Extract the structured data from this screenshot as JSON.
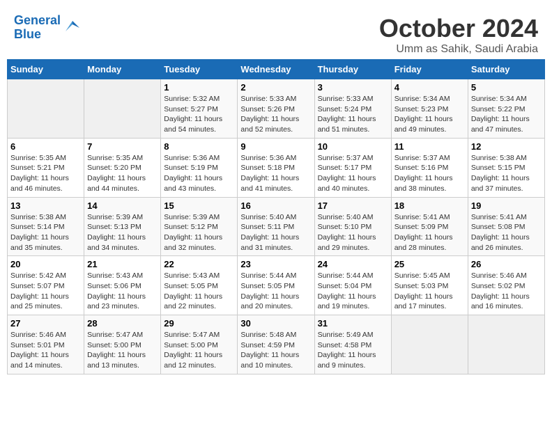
{
  "header": {
    "logo_line1": "General",
    "logo_line2": "Blue",
    "month": "October 2024",
    "location": "Umm as Sahik, Saudi Arabia"
  },
  "weekdays": [
    "Sunday",
    "Monday",
    "Tuesday",
    "Wednesday",
    "Thursday",
    "Friday",
    "Saturday"
  ],
  "weeks": [
    [
      {
        "day": null
      },
      {
        "day": null
      },
      {
        "day": "1",
        "sunrise": "Sunrise: 5:32 AM",
        "sunset": "Sunset: 5:27 PM",
        "daylight": "Daylight: 11 hours and 54 minutes."
      },
      {
        "day": "2",
        "sunrise": "Sunrise: 5:33 AM",
        "sunset": "Sunset: 5:26 PM",
        "daylight": "Daylight: 11 hours and 52 minutes."
      },
      {
        "day": "3",
        "sunrise": "Sunrise: 5:33 AM",
        "sunset": "Sunset: 5:24 PM",
        "daylight": "Daylight: 11 hours and 51 minutes."
      },
      {
        "day": "4",
        "sunrise": "Sunrise: 5:34 AM",
        "sunset": "Sunset: 5:23 PM",
        "daylight": "Daylight: 11 hours and 49 minutes."
      },
      {
        "day": "5",
        "sunrise": "Sunrise: 5:34 AM",
        "sunset": "Sunset: 5:22 PM",
        "daylight": "Daylight: 11 hours and 47 minutes."
      }
    ],
    [
      {
        "day": "6",
        "sunrise": "Sunrise: 5:35 AM",
        "sunset": "Sunset: 5:21 PM",
        "daylight": "Daylight: 11 hours and 46 minutes."
      },
      {
        "day": "7",
        "sunrise": "Sunrise: 5:35 AM",
        "sunset": "Sunset: 5:20 PM",
        "daylight": "Daylight: 11 hours and 44 minutes."
      },
      {
        "day": "8",
        "sunrise": "Sunrise: 5:36 AM",
        "sunset": "Sunset: 5:19 PM",
        "daylight": "Daylight: 11 hours and 43 minutes."
      },
      {
        "day": "9",
        "sunrise": "Sunrise: 5:36 AM",
        "sunset": "Sunset: 5:18 PM",
        "daylight": "Daylight: 11 hours and 41 minutes."
      },
      {
        "day": "10",
        "sunrise": "Sunrise: 5:37 AM",
        "sunset": "Sunset: 5:17 PM",
        "daylight": "Daylight: 11 hours and 40 minutes."
      },
      {
        "day": "11",
        "sunrise": "Sunrise: 5:37 AM",
        "sunset": "Sunset: 5:16 PM",
        "daylight": "Daylight: 11 hours and 38 minutes."
      },
      {
        "day": "12",
        "sunrise": "Sunrise: 5:38 AM",
        "sunset": "Sunset: 5:15 PM",
        "daylight": "Daylight: 11 hours and 37 minutes."
      }
    ],
    [
      {
        "day": "13",
        "sunrise": "Sunrise: 5:38 AM",
        "sunset": "Sunset: 5:14 PM",
        "daylight": "Daylight: 11 hours and 35 minutes."
      },
      {
        "day": "14",
        "sunrise": "Sunrise: 5:39 AM",
        "sunset": "Sunset: 5:13 PM",
        "daylight": "Daylight: 11 hours and 34 minutes."
      },
      {
        "day": "15",
        "sunrise": "Sunrise: 5:39 AM",
        "sunset": "Sunset: 5:12 PM",
        "daylight": "Daylight: 11 hours and 32 minutes."
      },
      {
        "day": "16",
        "sunrise": "Sunrise: 5:40 AM",
        "sunset": "Sunset: 5:11 PM",
        "daylight": "Daylight: 11 hours and 31 minutes."
      },
      {
        "day": "17",
        "sunrise": "Sunrise: 5:40 AM",
        "sunset": "Sunset: 5:10 PM",
        "daylight": "Daylight: 11 hours and 29 minutes."
      },
      {
        "day": "18",
        "sunrise": "Sunrise: 5:41 AM",
        "sunset": "Sunset: 5:09 PM",
        "daylight": "Daylight: 11 hours and 28 minutes."
      },
      {
        "day": "19",
        "sunrise": "Sunrise: 5:41 AM",
        "sunset": "Sunset: 5:08 PM",
        "daylight": "Daylight: 11 hours and 26 minutes."
      }
    ],
    [
      {
        "day": "20",
        "sunrise": "Sunrise: 5:42 AM",
        "sunset": "Sunset: 5:07 PM",
        "daylight": "Daylight: 11 hours and 25 minutes."
      },
      {
        "day": "21",
        "sunrise": "Sunrise: 5:43 AM",
        "sunset": "Sunset: 5:06 PM",
        "daylight": "Daylight: 11 hours and 23 minutes."
      },
      {
        "day": "22",
        "sunrise": "Sunrise: 5:43 AM",
        "sunset": "Sunset: 5:05 PM",
        "daylight": "Daylight: 11 hours and 22 minutes."
      },
      {
        "day": "23",
        "sunrise": "Sunrise: 5:44 AM",
        "sunset": "Sunset: 5:05 PM",
        "daylight": "Daylight: 11 hours and 20 minutes."
      },
      {
        "day": "24",
        "sunrise": "Sunrise: 5:44 AM",
        "sunset": "Sunset: 5:04 PM",
        "daylight": "Daylight: 11 hours and 19 minutes."
      },
      {
        "day": "25",
        "sunrise": "Sunrise: 5:45 AM",
        "sunset": "Sunset: 5:03 PM",
        "daylight": "Daylight: 11 hours and 17 minutes."
      },
      {
        "day": "26",
        "sunrise": "Sunrise: 5:46 AM",
        "sunset": "Sunset: 5:02 PM",
        "daylight": "Daylight: 11 hours and 16 minutes."
      }
    ],
    [
      {
        "day": "27",
        "sunrise": "Sunrise: 5:46 AM",
        "sunset": "Sunset: 5:01 PM",
        "daylight": "Daylight: 11 hours and 14 minutes."
      },
      {
        "day": "28",
        "sunrise": "Sunrise: 5:47 AM",
        "sunset": "Sunset: 5:00 PM",
        "daylight": "Daylight: 11 hours and 13 minutes."
      },
      {
        "day": "29",
        "sunrise": "Sunrise: 5:47 AM",
        "sunset": "Sunset: 5:00 PM",
        "daylight": "Daylight: 11 hours and 12 minutes."
      },
      {
        "day": "30",
        "sunrise": "Sunrise: 5:48 AM",
        "sunset": "Sunset: 4:59 PM",
        "daylight": "Daylight: 11 hours and 10 minutes."
      },
      {
        "day": "31",
        "sunrise": "Sunrise: 5:49 AM",
        "sunset": "Sunset: 4:58 PM",
        "daylight": "Daylight: 11 hours and 9 minutes."
      },
      {
        "day": null
      },
      {
        "day": null
      }
    ]
  ]
}
